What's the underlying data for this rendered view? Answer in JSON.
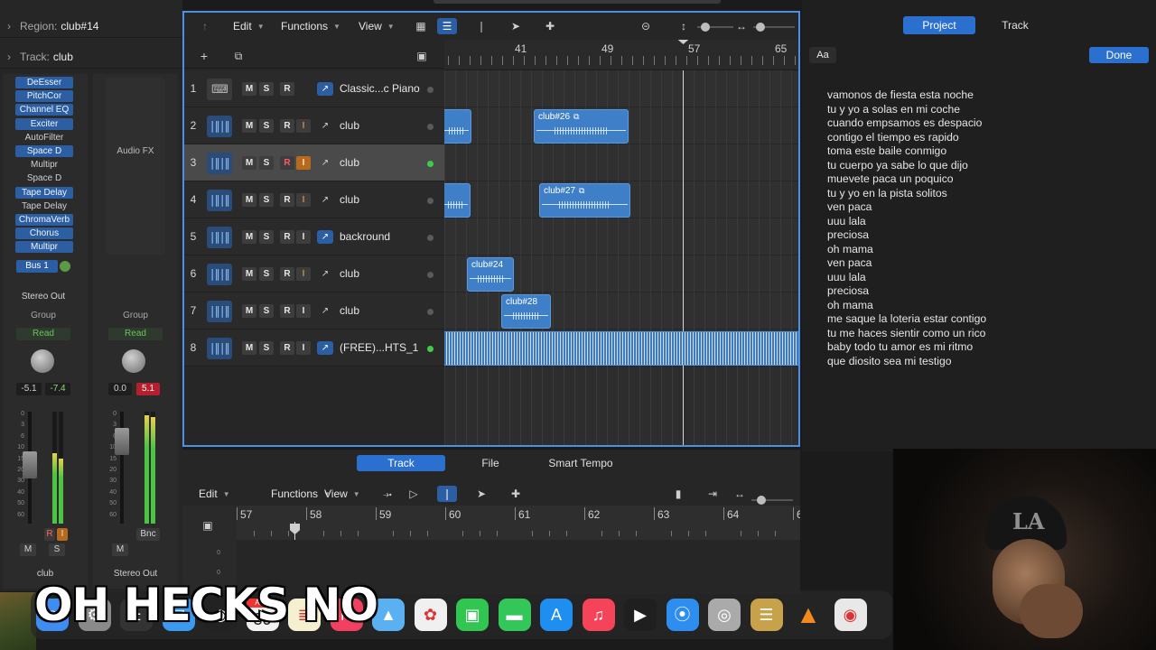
{
  "inspector": {
    "region_label": "Region:",
    "region_value": "club#14",
    "track_label": "Track:",
    "track_value": "club",
    "plugins": [
      {
        "name": "DeEsser",
        "on": true
      },
      {
        "name": "PitchCor",
        "on": true
      },
      {
        "name": "Channel EQ",
        "on": true
      },
      {
        "name": "Exciter",
        "on": true
      },
      {
        "name": "AutoFilter",
        "on": false
      },
      {
        "name": "Space D",
        "on": true
      },
      {
        "name": "Multipr",
        "on": false
      },
      {
        "name": "Space D",
        "on": false
      },
      {
        "name": "Tape Delay",
        "on": true
      },
      {
        "name": "Tape Delay",
        "on": false
      },
      {
        "name": "ChromaVerb",
        "on": true
      },
      {
        "name": "Chorus",
        "on": true
      },
      {
        "name": "Multipr",
        "on": true
      }
    ],
    "audio_fx_label": "Audio FX",
    "bus_label": "Bus 1",
    "stereo_out_label": "Stereo Out",
    "strip_a": {
      "group": "Group",
      "read": "Read",
      "vol": "-5.1",
      "peak": "-7.4",
      "name": "club",
      "m": "M",
      "s": "S",
      "r": "R",
      "i": "I"
    },
    "strip_b": {
      "group": "Group",
      "read": "Read",
      "vol": "0.0",
      "peak": "5.1",
      "name": "Stereo Out",
      "m": "M",
      "bnc": "Bnc"
    },
    "scale": [
      "0",
      "3",
      "6",
      "10",
      "15",
      "20",
      "30",
      "40",
      "50",
      "60"
    ]
  },
  "tracks_window": {
    "menus": [
      "Edit",
      "Functions",
      "View"
    ],
    "ruler_bars": [
      "41",
      "49",
      "57",
      "65"
    ],
    "tracks": [
      {
        "num": "1",
        "name": "Classic...c Piano",
        "icon": "piano-icon",
        "selected": false,
        "input": false,
        "dot": "off",
        "auto": true
      },
      {
        "num": "2",
        "name": "club",
        "icon": "waveform-icon",
        "selected": false,
        "input": true,
        "dot": "off",
        "auto": false
      },
      {
        "num": "3",
        "name": "club",
        "icon": "waveform-icon",
        "selected": true,
        "input": true,
        "dot": "green",
        "auto": false
      },
      {
        "num": "4",
        "name": "club",
        "icon": "waveform-icon",
        "selected": false,
        "input": true,
        "dot": "off",
        "auto": false
      },
      {
        "num": "5",
        "name": "backround",
        "icon": "waveform-icon",
        "selected": false,
        "input": false,
        "dot": "off",
        "auto": true
      },
      {
        "num": "6",
        "name": "club",
        "icon": "waveform-icon",
        "selected": false,
        "input": true,
        "dot": "off",
        "auto": false
      },
      {
        "num": "7",
        "name": "club",
        "icon": "waveform-icon",
        "selected": false,
        "input": false,
        "dot": "off",
        "auto": false
      },
      {
        "num": "8",
        "name": "(FREE)...HTS_1",
        "icon": "waveform-icon",
        "selected": false,
        "input": false,
        "dot": "green",
        "auto": true
      }
    ],
    "btn_m": "M",
    "btn_s": "S",
    "btn_r": "R",
    "btn_i": "I",
    "regions": {
      "r26": "club#26",
      "r27": "club#27",
      "r24": "club#24",
      "r28": "club#28"
    }
  },
  "editor": {
    "tabs": [
      "Track",
      "File",
      "Smart Tempo"
    ],
    "menus": [
      "Edit",
      "Functions",
      "View"
    ],
    "ruler_bars": [
      "57",
      "58",
      "59",
      "60",
      "61",
      "62",
      "63",
      "64",
      "6"
    ],
    "scale": [
      "0",
      "0"
    ]
  },
  "notes": {
    "tabs": [
      "Project",
      "Track"
    ],
    "aa_label": "Aa",
    "done_label": "Done",
    "lyrics": [
      "vamonos de fiesta esta noche",
      "tu y yo a solas en mi coche",
      "cuando empsamos es despacio",
      "contigo el tiempo es rapido",
      "toma este baile conmigo",
      "tu cuerpo ya sabe lo que dijo",
      "muevete paca un poquico",
      "tu y yo en la pista solitos",
      "ven paca",
      "uuu lala",
      "preciosa",
      "oh mama",
      "ven paca",
      "uuu lala",
      "preciosa",
      "oh mama",
      "me saque la loteria estar contigo",
      "tu me haces sientir como un rico",
      "baby todo tu amor es mi ritmo",
      "que diosito sea mi testigo"
    ]
  },
  "overlay": {
    "caption": "OH HECKS NO",
    "cap_logo": "LA"
  },
  "dock": {
    "calendar_month": "APR",
    "calendar_day": "30",
    "icons": [
      "finder-icon",
      "system-settings-icon",
      "calculator-icon",
      "mail-icon",
      "logic-icon",
      "calendar-icon",
      "notes-icon",
      "news-icon",
      "maps-icon",
      "photos-icon",
      "facetime-icon",
      "messages-icon",
      "app-store-icon",
      "music-icon",
      "final-cut-icon",
      "safari-icon",
      "compressor-icon",
      "archive-icon",
      "vlc-icon",
      "chrome-icon"
    ]
  }
}
